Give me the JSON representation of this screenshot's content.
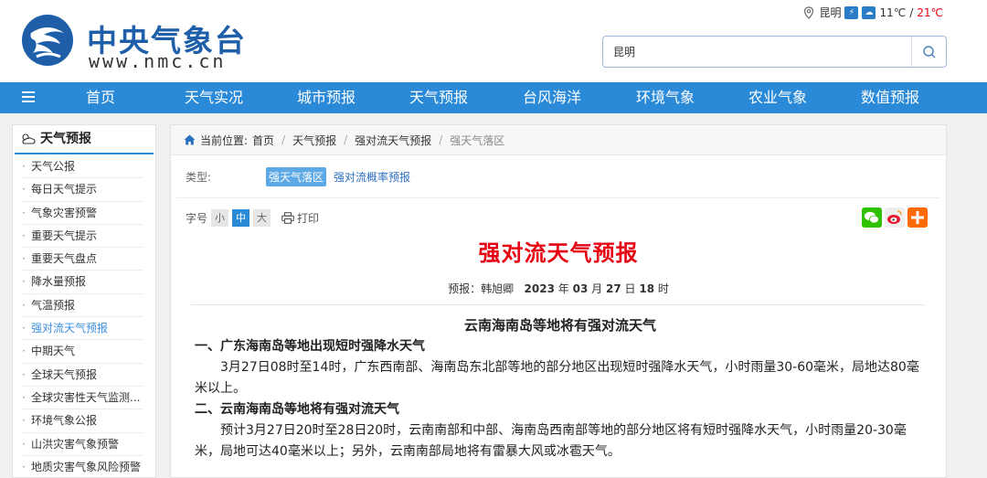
{
  "header": {
    "logo_cn": "中央气象台",
    "logo_en": "www.nmc.cn",
    "city": "昆明",
    "temp_low": "11℃",
    "temp_sep": "/",
    "temp_high": "21℃",
    "search_value": "昆明"
  },
  "nav": {
    "items": [
      "首页",
      "天气实况",
      "城市预报",
      "天气预报",
      "台风海洋",
      "环境气象",
      "农业气象",
      "数值预报"
    ]
  },
  "sidebar": {
    "title": "天气预报",
    "items": [
      "天气公报",
      "每日天气提示",
      "气象灾害预警",
      "重要天气提示",
      "重要天气盘点",
      "降水量预报",
      "气温预报",
      "强对流天气预报",
      "中期天气",
      "全球天气预报",
      "全球灾害性天气监测...",
      "环境气象公报",
      "山洪灾害气象预警",
      "地质灾害气象风险预警"
    ],
    "active_index": 7
  },
  "breadcrumb": {
    "prefix": "当前位置:",
    "items": [
      "首页",
      "天气预报",
      "强对流天气预报",
      "强天气落区"
    ],
    "separator": "/"
  },
  "types": {
    "label": "类型:",
    "active": "强天气落区",
    "other": "强对流概率预报"
  },
  "toolbar": {
    "font_label": "字号",
    "font_small": "小",
    "font_mid": "中",
    "font_large": "大",
    "print_label": "打印"
  },
  "article": {
    "title": "强对流天气预报",
    "by_prefix": "预报：韩旭卿",
    "year": "2023",
    "year_unit": "年",
    "month": "03",
    "month_unit": "月",
    "day": "27",
    "day_unit": "日",
    "hour": "18",
    "hour_unit": "时",
    "headline": "云南海南岛等地将有强对流天气",
    "h1": "一、广东海南岛等地出现短时强降水天气",
    "p1": "3月27日08时至14时，广东西南部、海南岛东北部等地的部分地区出现短时强降水天气，小时雨量30-60毫米，局地达80毫米以上。",
    "h2": "二、云南海南岛等地将有强对流天气",
    "p2": "预计3月27日20时至28日20时，云南南部和中部、海南岛西南部等地的部分地区将有短时强降水天气，小时雨量20-30毫米，局地可达40毫米以上；另外，云南南部局地将有雷暴大风或冰雹天气。"
  },
  "colors": {
    "nav_bg": "#2a8ad8",
    "title_red": "#e60012",
    "brand_blue": "#1f5fa9"
  }
}
